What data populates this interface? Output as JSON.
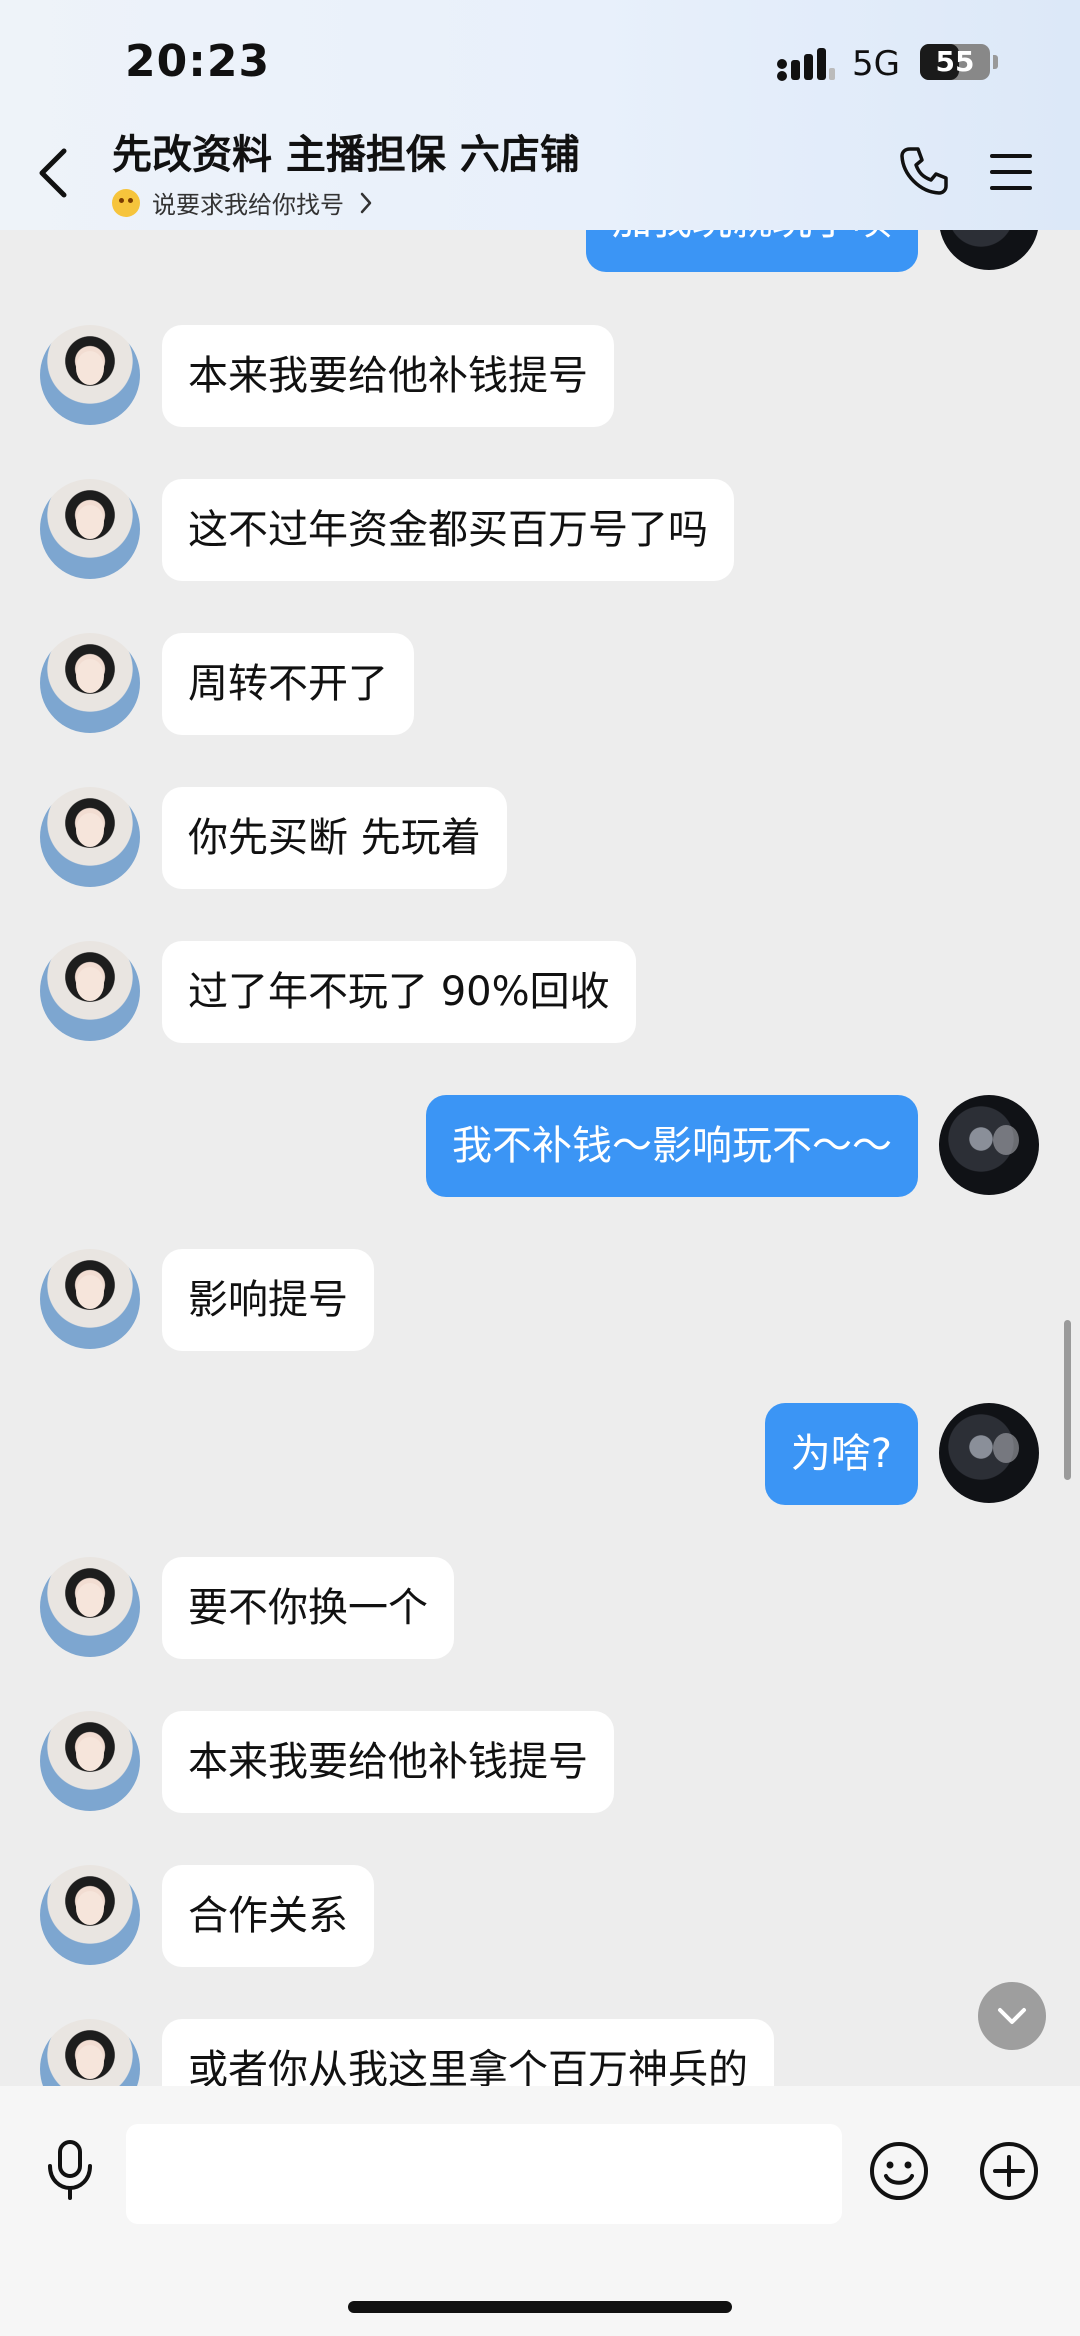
{
  "status_bar": {
    "time": "20:23",
    "network": "5G",
    "battery": "55",
    "battery_level_percent": 55,
    "signal_icon": "signal-bars-icon"
  },
  "header": {
    "title": "先改资料 主播担保 六店铺",
    "subtitle": "说要求我给你找号",
    "icons": [
      "back-chevron-icon",
      "phone-icon",
      "menu-icon",
      "emoji-icon",
      "chevron-right-icon"
    ]
  },
  "messages": [
    {
      "side": "out",
      "text": "加我玩就玩了呗"
    },
    {
      "side": "in",
      "text": "本来我要给他补钱提号"
    },
    {
      "side": "in",
      "text": "这不过年资金都买百万号了吗"
    },
    {
      "side": "in",
      "text": "周转不开了"
    },
    {
      "side": "in",
      "text": "你先买断 先玩着"
    },
    {
      "side": "in",
      "text": "过了年不玩了 90%回收"
    },
    {
      "side": "out",
      "text": "我不补钱～影响玩不～～"
    },
    {
      "side": "in",
      "text": "影响提号"
    },
    {
      "side": "out",
      "text": "为啥?"
    },
    {
      "side": "in",
      "text": "要不你换一个"
    },
    {
      "side": "in",
      "text": "本来我要给他补钱提号"
    },
    {
      "side": "in",
      "text": "合作关系"
    },
    {
      "side": "in",
      "text": "或者你从我这里拿个百万神兵的"
    }
  ],
  "input": {
    "placeholder": "",
    "value": ""
  },
  "colors": {
    "outgoing_bubble": "#3b95f5",
    "incoming_bubble": "#ffffff",
    "background": "#ededed"
  }
}
